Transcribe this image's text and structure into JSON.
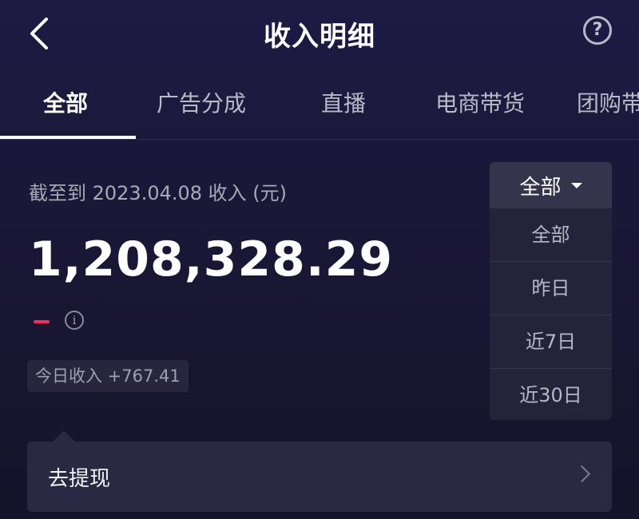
{
  "header": {
    "back_icon": "chevron-left-icon",
    "title": "收入明细",
    "help_glyph": "?"
  },
  "tabs": [
    {
      "label": "全部",
      "active": true
    },
    {
      "label": "广告分成",
      "active": false
    },
    {
      "label": "直播",
      "active": false
    },
    {
      "label": "电商带货",
      "active": false
    },
    {
      "label": "团购带",
      "active": false
    }
  ],
  "summary": {
    "as_of": "截至到 2023.04.08 收入 (元)",
    "amount": "1,208,328.29",
    "trend_sign": "–",
    "info_glyph": "i",
    "today_income": "今日收入 +767.41"
  },
  "withdraw": {
    "label": "去提现"
  },
  "filter": {
    "selected": "全部",
    "options": [
      "全部",
      "昨日",
      "近7日",
      "近30日"
    ]
  },
  "colors": {
    "background": "#1d1b44",
    "card": "#2a2944",
    "accent_red": "#ff2a55"
  }
}
